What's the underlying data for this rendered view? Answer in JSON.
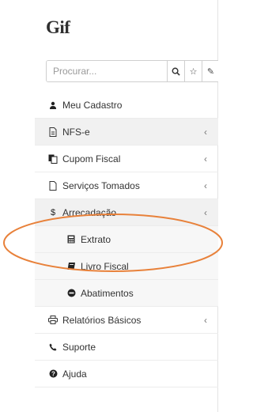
{
  "logo": "Gif",
  "search": {
    "placeholder": "Procurar..."
  },
  "menu": {
    "cadastro": "Meu Cadastro",
    "nfse": "NFS-e",
    "cupom": "Cupom Fiscal",
    "servicos": "Serviços Tomados",
    "arrecadacao": "Arrecadação",
    "extrato": "Extrato",
    "livro": "Livro Fiscal",
    "abatimentos": "Abatimentos",
    "relatorios": "Relatórios Básicos",
    "suporte": "Suporte",
    "ajuda": "Ajuda"
  },
  "colors": {
    "annotation": "#e8813a"
  }
}
